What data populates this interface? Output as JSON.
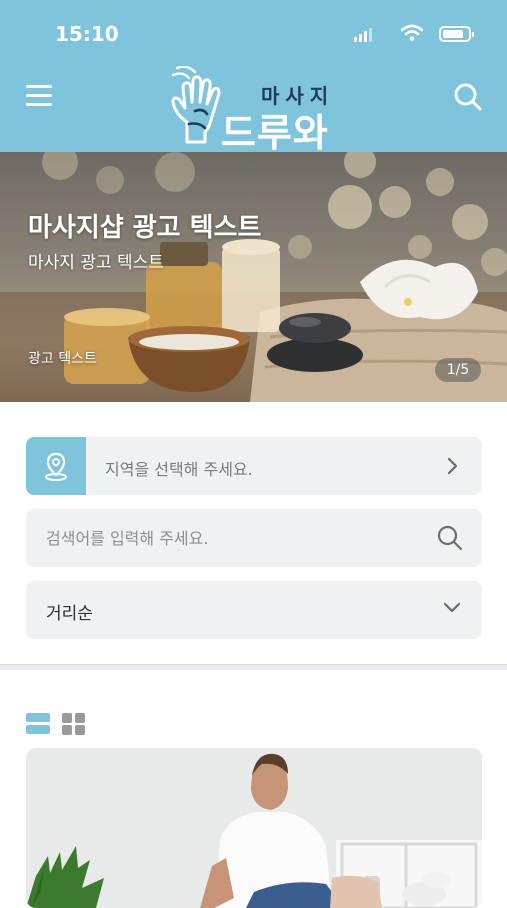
{
  "status_bar": {
    "time": "15:10"
  },
  "header": {
    "logo": {
      "top_text": "마사지",
      "main_text": "드루와"
    },
    "icons": {
      "menu": "menu-icon",
      "search": "search-icon"
    },
    "background_color": "#7fc4dc"
  },
  "banner": {
    "title": "마사지샵 광고 텍스트",
    "subtitle": "마사지 광고 텍스트",
    "caption": "광고 텍스트",
    "counter": "1/5"
  },
  "filters": {
    "region": {
      "placeholder": "지역을 선택해 주세요.",
      "icon": "location-pin-icon"
    },
    "search": {
      "placeholder": "검색어를 입력해 주세요.",
      "icon": "search-icon"
    },
    "sort": {
      "selected": "거리순",
      "icon": "chevron-down-icon"
    }
  },
  "view_toggle": {
    "active": "list",
    "icons": [
      "list-view-icon",
      "grid-view-icon"
    ]
  },
  "colors": {
    "accent": "#7fc4dc",
    "inactive_icon": "#9a9a9a"
  }
}
